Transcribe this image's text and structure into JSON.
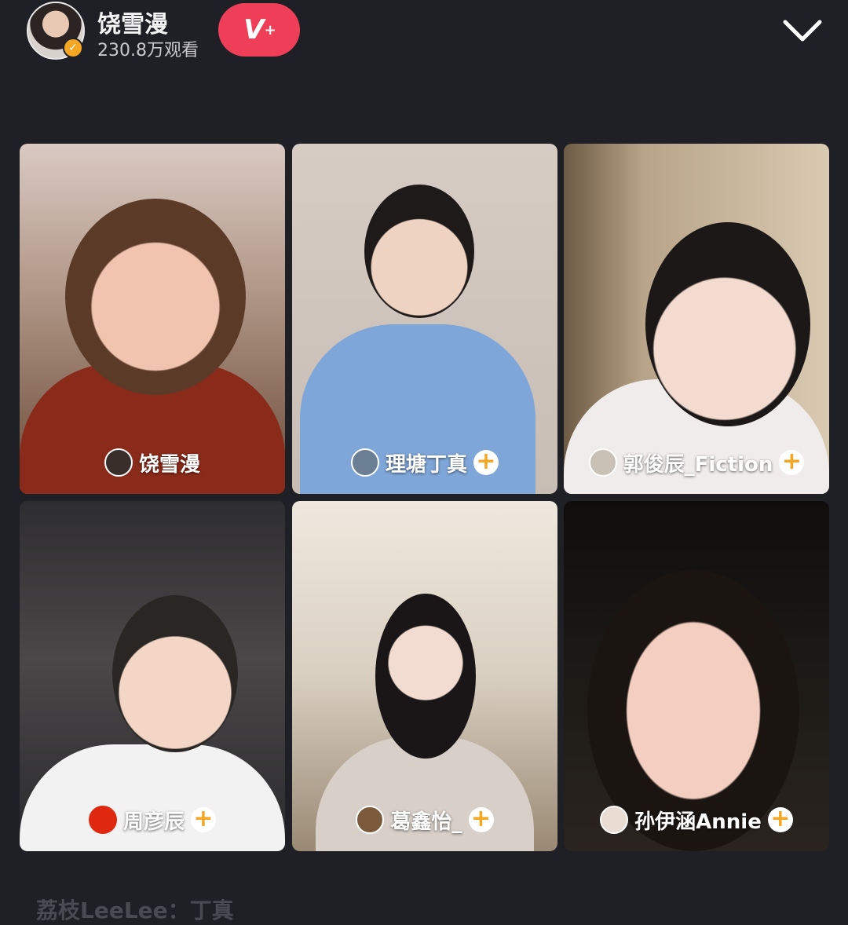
{
  "header": {
    "host_name": "饶雪漫",
    "view_count": "230.8万观看",
    "follow_label": "V",
    "follow_plus": "+"
  },
  "colors": {
    "follow": "#ef3e57",
    "badge": "#f5a623",
    "background": "#1f2026"
  },
  "tiles": [
    {
      "name": "饶雪漫",
      "has_add": false
    },
    {
      "name": "理塘丁真",
      "has_add": true
    },
    {
      "name": "郭俊辰_Fiction",
      "has_add": true
    },
    {
      "name": "周彦辰",
      "has_add": true
    },
    {
      "name": "葛鑫怡_",
      "has_add": true
    },
    {
      "name": "孙伊涵Annie",
      "has_add": true
    }
  ],
  "add_symbol": "+",
  "comment": {
    "text": "荔枝LeeLee：丁真"
  }
}
